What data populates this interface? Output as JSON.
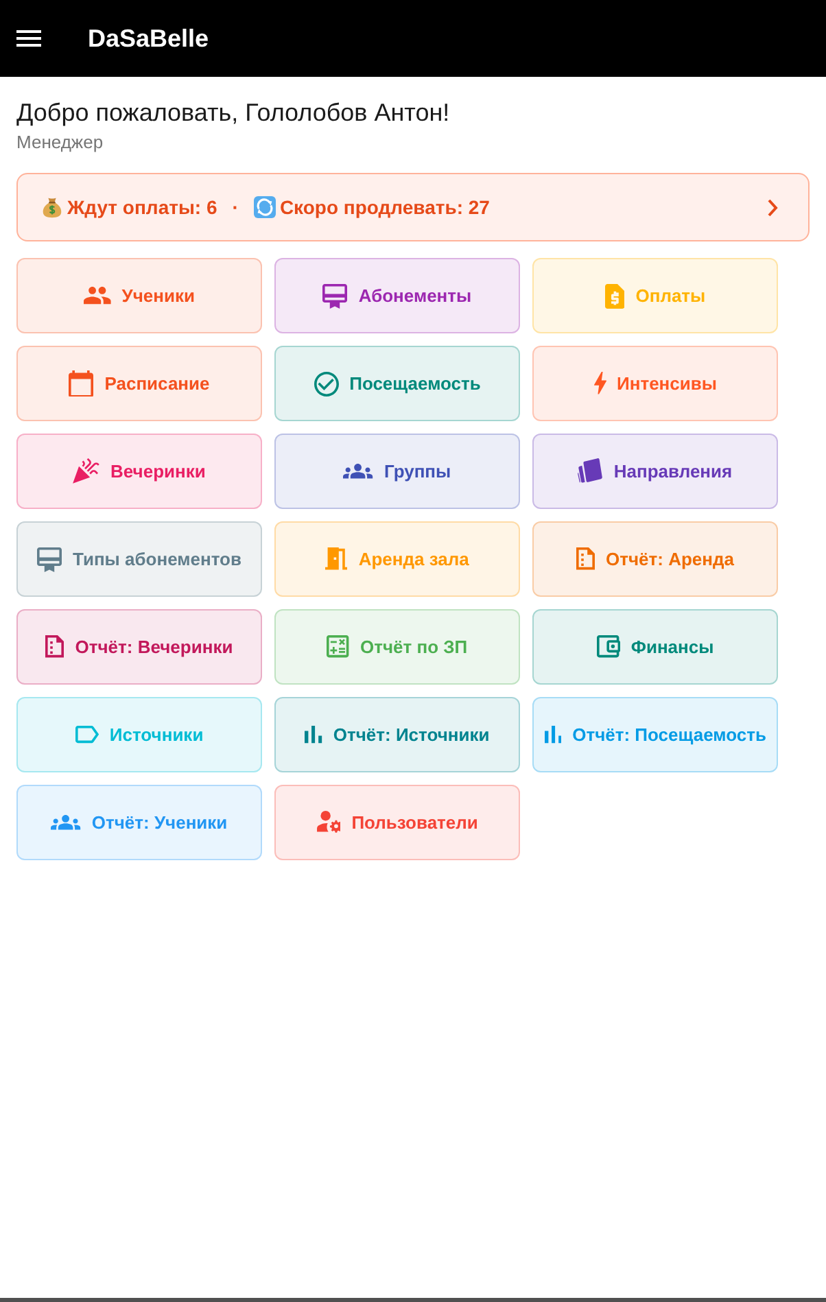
{
  "app_bar": {
    "title": "DaSaBelle"
  },
  "welcome": {
    "title": "Добро пожаловать, Гололобов Антон!",
    "role": "Менеджер"
  },
  "alert": {
    "items": [
      {
        "kind": "money",
        "text": "Ждут оплаты: 6"
      },
      {
        "kind": "renew",
        "text": "Скоро продлевать: 27"
      }
    ],
    "separator": "·"
  },
  "tiles": [
    {
      "label": "Ученики",
      "kind": "people",
      "color": "#f4511e"
    },
    {
      "label": "Абонементы",
      "kind": "certificate",
      "color": "#9c27b0"
    },
    {
      "label": "Оплаты",
      "kind": "invoice",
      "color": "#ffb300"
    },
    {
      "label": "Расписание",
      "kind": "calendar",
      "color": "#f4511e"
    },
    {
      "label": "Посещаемость",
      "kind": "check",
      "color": "#00897b"
    },
    {
      "label": "Интенсивы",
      "kind": "lightning",
      "color": "#ff5722"
    },
    {
      "label": "Вечеринки",
      "kind": "popper",
      "color": "#e91e63"
    },
    {
      "label": "Группы",
      "kind": "group",
      "color": "#3f51b5"
    },
    {
      "label": "Направления",
      "kind": "cards",
      "color": "#673ab7"
    },
    {
      "label": "Типы абонементов",
      "kind": "certificate",
      "color": "#607d8b"
    },
    {
      "label": "Аренда зала",
      "kind": "door",
      "color": "#ff9800"
    },
    {
      "label": "Отчёт: Аренда",
      "kind": "document",
      "color": "#ef6c00"
    },
    {
      "label": "Отчёт: Вечеринки",
      "kind": "document",
      "color": "#c2185b"
    },
    {
      "label": "Отчёт по ЗП",
      "kind": "calculator",
      "color": "#4caf50"
    },
    {
      "label": "Финансы",
      "kind": "wallet",
      "color": "#00897b"
    },
    {
      "label": "Источники",
      "kind": "tag",
      "color": "#00bcd4"
    },
    {
      "label": "Отчёт: Источники",
      "kind": "chart",
      "color": "#00838f"
    },
    {
      "label": "Отчёт: Посещаемость",
      "kind": "chart",
      "color": "#039be5"
    },
    {
      "label": "Отчёт: Ученики",
      "kind": "group",
      "color": "#2196f3"
    },
    {
      "label": "Пользователи",
      "kind": "usergear",
      "color": "#f44336"
    }
  ]
}
